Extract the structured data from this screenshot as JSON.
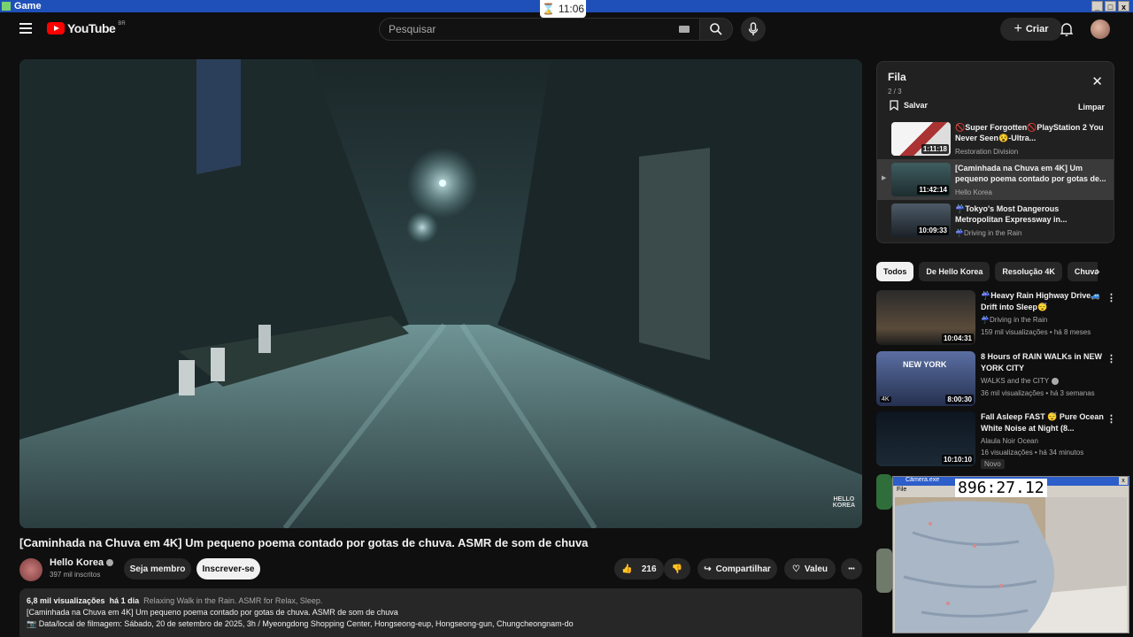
{
  "window": {
    "title": "Game",
    "clock": "11:06"
  },
  "header": {
    "logo_text": "YouTube",
    "logo_region": "BR",
    "search_placeholder": "Pesquisar",
    "create_label": "Criar"
  },
  "video": {
    "watermark_line1": "HELLO",
    "watermark_line2": "KOREA",
    "title": "[Caminhada na Chuva em 4K] Um pequeno poema contado por gotas de chuva. ASMR de som de chuva",
    "channel_name": "Hello Korea",
    "channel_subs": "397 mil inscritos",
    "member_label": "Seja membro",
    "subscribe_label": "Inscrever-se",
    "likes": "216",
    "share_label": "Compartilhar",
    "thanks_label": "Valeu",
    "more_label": "•••"
  },
  "description": {
    "views": "6,8 mil visualizações",
    "age": "há 1 dia",
    "tags": "Relaxing Walk in the Rain. ASMR for Relax, Sleep.",
    "line2": "[Caminhada na Chuva em 4K] Um pequeno poema contado por gotas de chuva. ASMR de som de chuva",
    "line3": "📷 Data/local de filmagem: Sábado, 20 de setembro de 2025, 3h / Myeongdong Shopping Center, Hongseong-eup, Hongseong-gun, Chungcheongnam-do"
  },
  "queue": {
    "title": "Fila",
    "count": "2 / 3",
    "save_label": "Salvar",
    "clear_label": "Limpar",
    "close_icon": "✕",
    "items": [
      {
        "title": "🚫Super Forgotten🚫PlayStation 2 You Never Seen😵-Ultra...",
        "channel": "Restoration Division",
        "duration": "1:11:18"
      },
      {
        "title": "[Caminhada na Chuva em 4K] Um pequeno poema contado por gotas de...",
        "channel": "Hello Korea",
        "duration": "11:42:14"
      },
      {
        "title": "☔Tokyo's Most Dangerous Metropolitan Expressway in...",
        "channel": "☔Driving in the Rain",
        "duration": "10:09:33"
      }
    ]
  },
  "chips": [
    "Todos",
    "De Hello Korea",
    "Resolução 4K",
    "Chuva"
  ],
  "recommendations": [
    {
      "title": "☔Heavy Rain Highway Drive🚙Drift into Sleep😴",
      "channel": "☔Driving in the Rain",
      "meta": "159 mil visualizações • há 8 meses",
      "duration": "10:04:31"
    },
    {
      "title": "8 Hours of RAIN WALKs in NEW YORK CITY",
      "channel": "WALKS and the CITY",
      "meta": "36 mil visualizações • há 3 semanas",
      "duration": "8:00:30",
      "thumb_text": "NEW YORK",
      "badge": "4K"
    },
    {
      "title": "Fall Asleep FAST 😴 Pure Ocean White Noise at Night (8...",
      "channel": "Alaula Noir Ocean",
      "meta": "16 visualizações • há 34 minutos",
      "duration": "10:10:10",
      "badge": "Novo"
    }
  ],
  "webcam": {
    "title": "Câmera.exe",
    "menu": "File",
    "timer": "896:27.12",
    "close": "x"
  },
  "colors": {
    "background": "#0f0f0f",
    "surface": "#272727",
    "brand_red": "#ff0000",
    "text": "#f1f1f1",
    "muted": "#aaaaaa"
  }
}
